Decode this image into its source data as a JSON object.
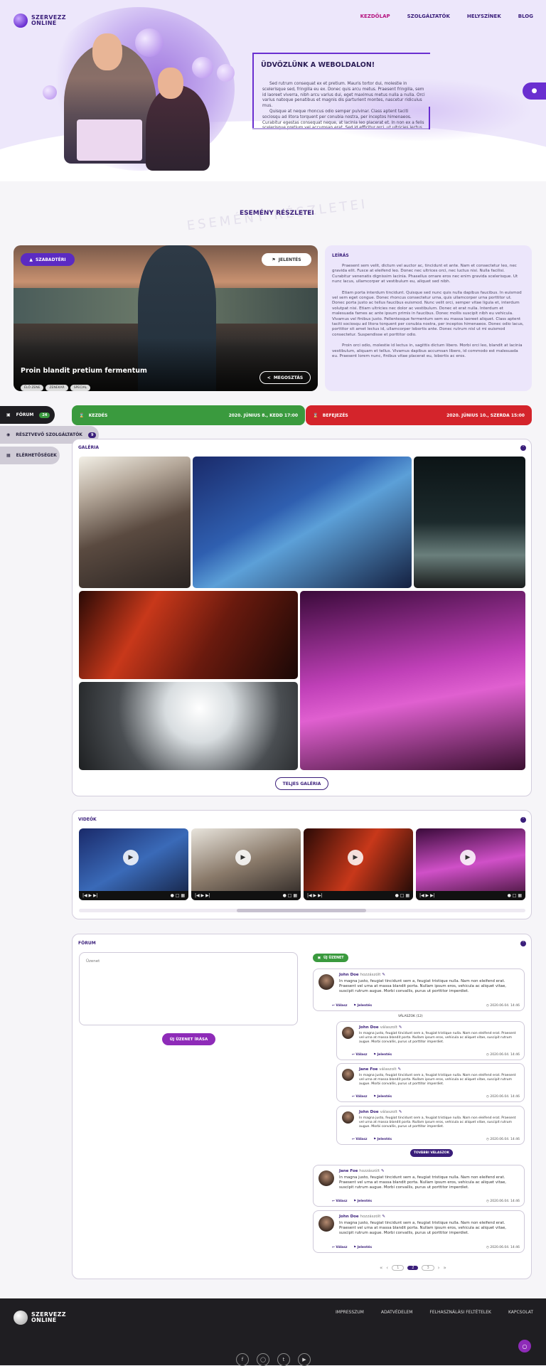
{
  "brand": {
    "line1": "SZERVEZZ",
    "line2": "ONLINE"
  },
  "nav": {
    "items": [
      "KEZDŐLAP",
      "SZOLGÁLTATÓK",
      "HELYSZÍNEK",
      "BLOG"
    ]
  },
  "hero": {
    "title": "ÜDVÖZLÜNK A WEBOLDALON!",
    "para1": "Sed rutrum consequat ex et pretium. Mauris tortor dui, molestie in scelerisque sed, fringilla eu ex. Donec quis arcu metus. Praesent fringilla, sem id laoreet viverra, nibh arcu varius dui, eget maximus metus nulla a nulla. Orci varius natoque penatibus et magnis dis parturient montes, nascetur ridiculus mus.",
    "para2": "Quisque at neque rhoncus odio semper pulvinar. Class aptent taciti sociosqu ad litora torquent per conubia nostra, per inceptos himenaeos. Curabitur egestas consequat neque, at lacinia leo placerat et. In non ex a felis scelerisque pretium vel accumsan erat. Sed id efficitur orci, ut ultricies lectus."
  },
  "event": {
    "section_title": "ESEMÉNY RÉSZLETEI",
    "ghost_title": "ESEMÉNY RÉSZLETEI",
    "badge": "SZABADTÉRI",
    "report": "JELENTÉS",
    "name": "Proin blandit pretium fermentum",
    "tags": [
      "ÉLŐ ZENE",
      "ZENEKAR",
      "SPECIAL"
    ],
    "share": "MEGOSZTÁS",
    "desc_title": "LEÍRÁS",
    "desc_p1": "Praesent sem velit, dictum vel auctor ac, tincidunt et ante. Nam et consectetur leo, nec gravida elit. Fusce at eleifend leo. Donec nec ultrices orci, nec luctus nisi. Nulla facilisi. Curabitur venenatis dignissim lacinia. Phasellus ornare eros nec enim gravida scelerisque. Ut nunc lacus, ullamcorper at vestibulum eu, aliquet sed nibh.",
    "desc_p2": "Etiam porta interdum tincidunt. Quisque sed nunc quis nulla dapibus faucibus. In euismod vel sem eget congue. Donec rhoncus consectetur urna, quis ullamcorper urna porttitor ut. Donec porta justo ac tellus faucibus euismod. Nunc velit orci, semper vitae ligula et, interdum volutpat nisi. Etiam ultricies nec dolor ac vestibulum. Donec et erat nulla. Interdum et malesuada fames ac ante ipsum primis in faucibus. Donec mollis suscipit nibh eu vehicula. Vivamus vel finibus justo. Pellentesque fermentum sem eu massa laoreet aliquet. Class aptent taciti sociosqu ad litora torquent per conubia nostra, per inceptos himenaeos. Donec odio lacus, porttitor sit amet lectus id, ullamcorper lobortis ante. Donec rutrum nisl ut mi euismod consectetur. Suspendisse et porttitor odio.",
    "desc_p3": "Proin orci odio, molestie id lectus in, sagittis dictum libero. Morbi orci leo, blandit at lacinia vestibulum, aliquam et tellus. Vivamus dapibus accumsan libero, id commodo est malesuada eu. Praesent lorem nunc, finibus vitae placerat eu, lobortis ac eros."
  },
  "side_tabs": [
    {
      "label": "FÓRUM",
      "count": "24"
    },
    {
      "label": "RÉSZTVEVŐ SZOLGÁLTATÓK",
      "count": "9"
    },
    {
      "label": "ELÉRHETŐSÉGEK",
      "count": ""
    }
  ],
  "schedule": {
    "start_label": "KEZDÉS",
    "start_value": "2020. JÚNIUS 8., KEDD 17:00",
    "end_label": "BEFEJEZÉS",
    "end_value": "2020. JÚNIUS 10., SZERDA 15:00"
  },
  "gallery": {
    "title": "GALÉRIA",
    "button": "TELJES GALÉRIA"
  },
  "videos": {
    "title": "VIDEÓK"
  },
  "forum": {
    "title": "FÓRUM",
    "placeholder": "Üzenet",
    "write_button": "ÚJ ÜZENET ÍRÁSA",
    "new_badge": "ÚJ ÜZENET",
    "replies_label": "VÁLASZOK (12)",
    "more_replies": "TOVÁBBI VÁLASZOK",
    "comment_text": "In magna justo, feugiat tincidunt sem a, feugiat tristique nulla. Nam non eleifend erat. Praesent vel urna at massa blandit porta. Nullam ipsum eros, vehicula ac aliquet vitae, suscipit rutrum augue. Morbi convallis, purus ut porttitor imperdiet.",
    "reply_label": "Válasz",
    "report_label": "Jelentés",
    "date": "2020.06.04. 14:46",
    "comments": [
      {
        "name": "John Doe",
        "role": "hozzászólt"
      },
      {
        "name": "John Doe",
        "role": "válaszolt"
      },
      {
        "name": "Jane Foe",
        "role": "válaszolt"
      },
      {
        "name": "John Doe",
        "role": "válaszolt"
      },
      {
        "name": "Jane Foe",
        "role": "hozzászólt"
      },
      {
        "name": "John Doe",
        "role": "hozzászólt"
      }
    ],
    "pagination": [
      "«",
      "‹",
      "1",
      "2",
      "3",
      "›",
      "»"
    ]
  },
  "footer": {
    "links": [
      "IMPRESSZUM",
      "ADATVÉDELEM",
      "FELHASZNÁLÁSI FELTÉTELEK",
      "KAPCSOLAT"
    ]
  },
  "colors": {
    "primary": "#3a1e7a",
    "accent": "#6a2fd0",
    "green": "#3a9a3e",
    "red": "#d4242b",
    "pink": "#b5147f"
  }
}
